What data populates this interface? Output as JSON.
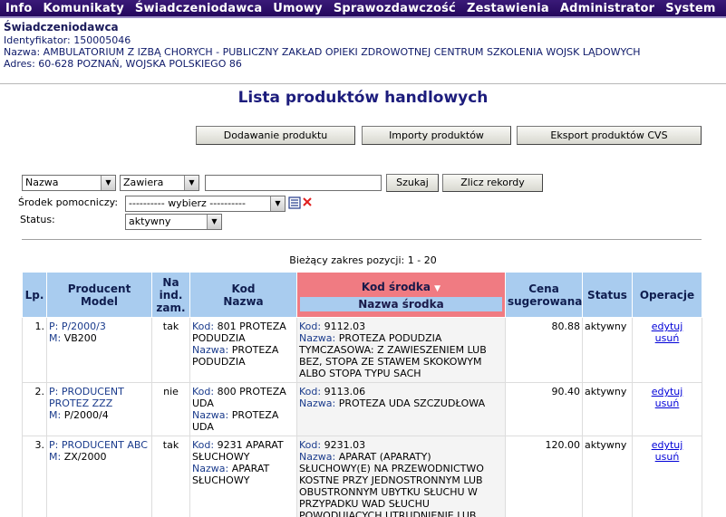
{
  "menu": [
    "Info",
    "Komunikaty",
    "Świadczeniodawca",
    "Umowy",
    "Sprawozdawczość",
    "Zestawienia",
    "Administrator",
    "System"
  ],
  "provider": {
    "title": "Świadczeniodawca",
    "ident": "Identyfikator: 150005046",
    "name": "Nazwa: AMBULATORIUM Z IZBĄ CHORYCH - PUBLICZNY ZAKŁAD OPIEKI ZDROWOTNEJ CENTRUM SZKOLENIA WOJSK LĄDOWYCH",
    "address": "Adres: 60-628 POZNAŃ, WOJSKA POLSKIEGO 86"
  },
  "page_title": "Lista produktów handlowych",
  "actions": {
    "add": "Dodawanie produktu",
    "import": "Importy produktów",
    "export": "Eksport produktów CVS"
  },
  "filter": {
    "field": "Nazwa",
    "operator": "Zawiera",
    "text_value": "",
    "search_btn": "Szukaj",
    "count_btn": "Zlicz rekordy",
    "aid_label": "Środek pomocniczy:",
    "aid_value": "---------- wybierz ----------",
    "status_label": "Status:",
    "status_value": "aktywny"
  },
  "range_text": "Bieżący zakres pozycji: 1 - 20",
  "table": {
    "h_lp": "Lp.",
    "h_prod1": "Producent",
    "h_prod2": "Model",
    "h_ind1": "Na",
    "h_ind2": "ind.",
    "h_ind3": "zam.",
    "h_kod1": "Kod",
    "h_kod2": "Nazwa",
    "h_ks1": "Kod środka",
    "h_ks2": "Nazwa środka",
    "h_cena1": "Cena",
    "h_cena2": "sugerowana",
    "h_status": "Status",
    "h_ops": "Operacje",
    "p_label": "P:",
    "m_label": "M:",
    "kod_label": "Kod:",
    "nazwa_label": "Nazwa:",
    "edit": "edytuj",
    "del": "usuń",
    "rows": [
      {
        "lp": "1.",
        "producer": "P/2000/3",
        "model": "VB200",
        "ind": "tak",
        "kod": "801 PROTEZA PODUDZIA",
        "nazwa": "PROTEZA PODUDZIA",
        "ks_kod": "9112.03",
        "ks_nazwa": "PROTEZA PODUDZIA TYMCZASOWA: Z ZAWIESZENIEM LUB BEZ, STOPA ZE STAWEM SKOKOWYM ALBO STOPA TYPU SACH",
        "cena": "80.88",
        "status": "aktywny"
      },
      {
        "lp": "2.",
        "producer": "PRODUCENT PROTEZ ZZZ",
        "model": "P/2000/4",
        "ind": "nie",
        "kod": "800 PROTEZA UDA",
        "nazwa": "PROTEZA UDA",
        "ks_kod": "9113.06",
        "ks_nazwa": "PROTEZA UDA SZCZUDŁOWA",
        "cena": "90.40",
        "status": "aktywny"
      },
      {
        "lp": "3.",
        "producer": "PRODUCENT ABC",
        "model": "ZX/2000",
        "ind": "tak",
        "kod": "9231 APARAT SŁUCHOWY",
        "nazwa": "APARAT SŁUCHOWY",
        "ks_kod": "9231.03",
        "ks_nazwa": "APARAT (APARATY) SŁUCHOWY(E) NA PRZEWODNICTWO KOSTNE PRZY JEDNOSTRONNYM LUB OBUSTRONNYM UBYTKU SŁUCHU W PRZYPADKU WAD SŁUCHU POWODUJĄCYCH UTRUDNIENIE LUB OGRANICZENIE W NABYWANIU",
        "cena": "120.00",
        "status": "aktywny"
      }
    ]
  }
}
